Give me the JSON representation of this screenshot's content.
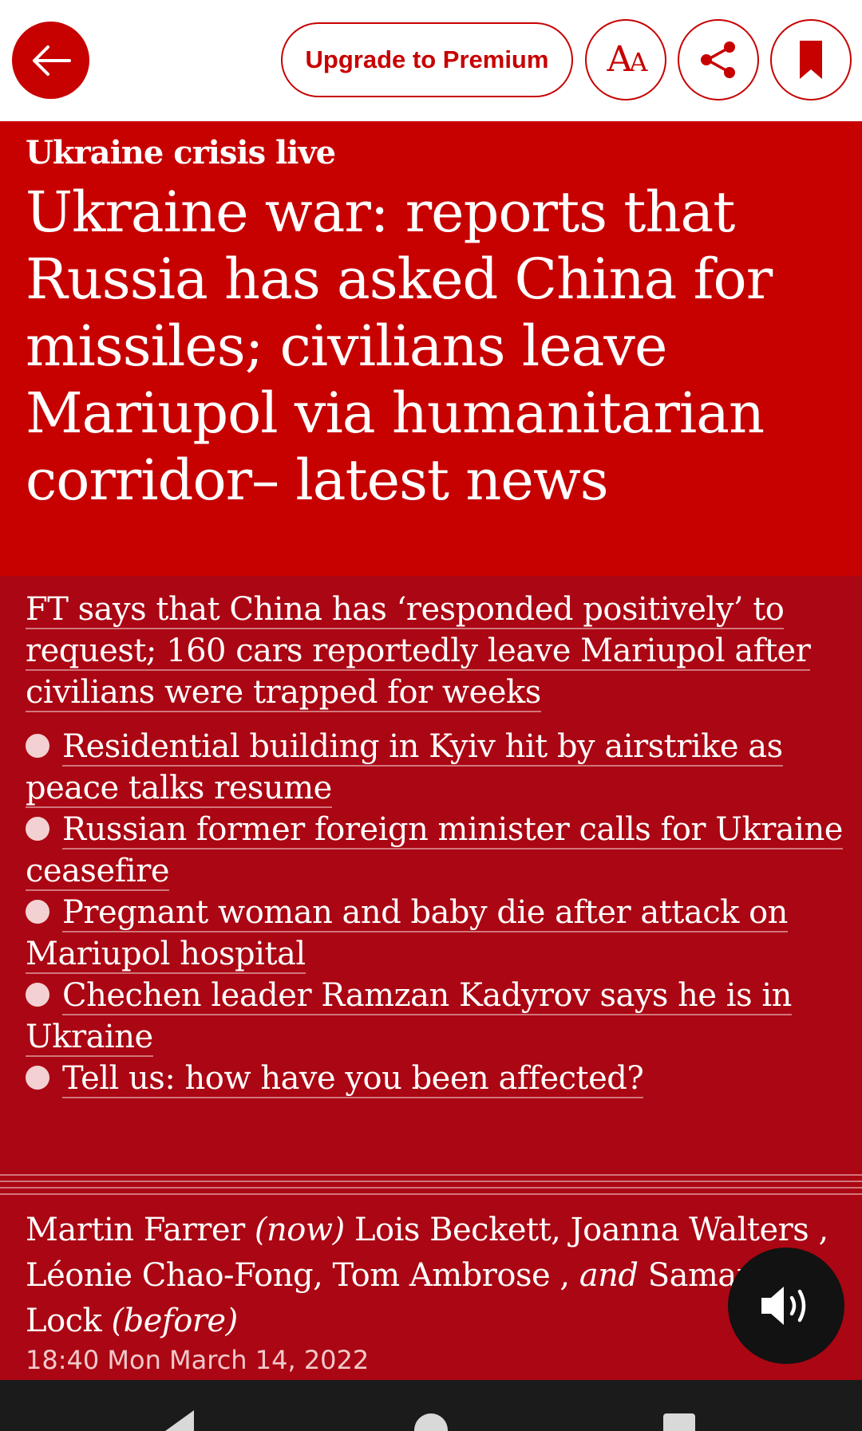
{
  "toolbar": {
    "back_icon": "arrow-left-icon",
    "premium_label": "Upgrade to Premium",
    "font_icon": "text-size-icon",
    "font_glyph_big": "A",
    "font_glyph_small": "A",
    "share_icon": "share-icon",
    "bookmark_icon": "bookmark-icon"
  },
  "article": {
    "kicker": "Ukraine crisis live",
    "headline": "Ukraine war: reports that Russia has asked China for missiles; civilians leave Mariupol via humanitarian corridor– latest news",
    "standfirst": "FT says that China has ‘responded positively’ to request; 160 cars reportedly leave Mariupol after civilians were trapped for weeks",
    "bullets": [
      "Residential building in Kyiv hit by airstrike as peace talks resume",
      "Russian former foreign minister calls for Ukraine ceasefire",
      "Pregnant woman and baby die after attack on Mariupol hospital",
      "Chechen leader Ramzan Kadyrov says he is in Ukraine",
      "Tell us: how have you been affected?"
    ]
  },
  "byline": {
    "author_now": "Martin Farrer",
    "now_label": "(now)",
    "author_1": "Lois Beckett,",
    "author_2": "Joanna Walters",
    "sep_1": " ,",
    "author_3": "Léonie Chao-Fong,",
    "author_4": "Tom Ambrose",
    "sep_2": " ,",
    "and_label": "and",
    "author_5": "Samantha Lock",
    "before_label": "(before)",
    "timestamp": "18:40 Mon March 14, 2022"
  },
  "audio": {
    "icon": "speaker-icon"
  },
  "colors": {
    "brand_red": "#c70000",
    "body_red": "#ab0613",
    "white": "#ffffff",
    "fab_dark": "#121212"
  }
}
